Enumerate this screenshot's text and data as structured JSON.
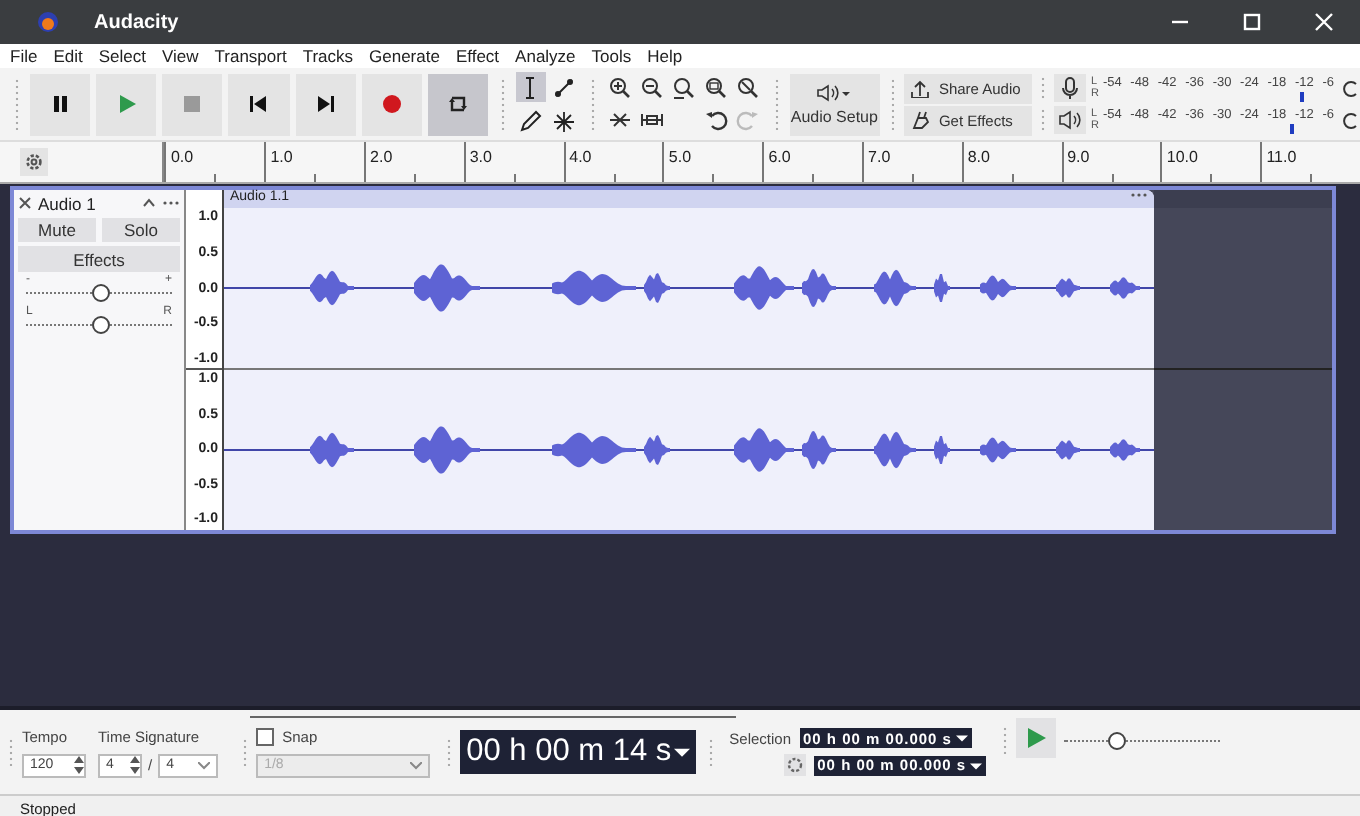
{
  "window": {
    "title": "Audacity"
  },
  "menu": [
    "File",
    "Edit",
    "Select",
    "View",
    "Transport",
    "Tracks",
    "Generate",
    "Effect",
    "Analyze",
    "Tools",
    "Help"
  ],
  "transport": [
    {
      "kind": "pause",
      "selected": false
    },
    {
      "kind": "play",
      "selected": false
    },
    {
      "kind": "stop",
      "selected": false
    },
    {
      "kind": "skip-start",
      "selected": false
    },
    {
      "kind": "skip-end",
      "selected": false
    },
    {
      "kind": "record",
      "selected": false
    },
    {
      "kind": "loop",
      "selected": true
    }
  ],
  "tools": [
    {
      "kind": "select",
      "selected": true
    },
    {
      "kind": "envelope",
      "selected": false
    },
    {
      "kind": "draw",
      "selected": false
    },
    {
      "kind": "multi",
      "selected": false
    }
  ],
  "history": [
    {
      "kind": "undo",
      "disabled": false
    },
    {
      "kind": "redo",
      "disabled": true
    }
  ],
  "audio_setup": {
    "label": "Audio Setup"
  },
  "share": [
    {
      "kind": "share",
      "label": "Share Audio"
    },
    {
      "kind": "effects",
      "label": "Get Effects"
    }
  ],
  "meters": [
    {
      "kind": "record",
      "left": "L",
      "right": "R",
      "scale": [
        "-54",
        "-48",
        "-42",
        "-36",
        "-30",
        "-24",
        "-18",
        "-12",
        "-6"
      ],
      "level": 0.84
    },
    {
      "kind": "playback",
      "left": "L",
      "right": "R",
      "scale": [
        "-54",
        "-48",
        "-42",
        "-36",
        "-30",
        "-24",
        "-18",
        "-12",
        "-6"
      ],
      "level": 0.8
    }
  ],
  "timeline": {
    "ticks": [
      "0.0",
      "1.0",
      "2.0",
      "3.0",
      "4.0",
      "5.0",
      "6.0",
      "7.0",
      "8.0",
      "9.0",
      "10.0",
      "11.0"
    ]
  },
  "track": {
    "name": "Audio 1",
    "buttons": [
      "Mute",
      "Solo"
    ],
    "effects": "Effects",
    "gain": {
      "min": "-",
      "max": "+",
      "level": 0.5
    },
    "pan": {
      "left": "L",
      "right": "R",
      "level": 0.5
    },
    "clip": "Audio 1.1",
    "channels": [
      {
        "scale": [
          "1.0",
          "0.5",
          "0.0",
          "-0.5",
          "-1.0"
        ]
      },
      {
        "scale": [
          "1.0",
          "0.5",
          "0.0",
          "-0.5",
          "-1.0"
        ]
      }
    ]
  },
  "bottom": {
    "tempo": {
      "label": "Tempo",
      "value": "120"
    },
    "time_signature": {
      "label": "Time Signature",
      "upper": "4",
      "separator": "/",
      "lower": "4"
    },
    "snap": {
      "label": "Snap",
      "checked": false,
      "value": "1/8",
      "disabled": true
    },
    "time": "00 h 00 m 14 s",
    "selection": {
      "label": "Selection",
      "start": "00 h 00 m 00.000 s",
      "end": "00 h 00 m 00.000 s"
    },
    "play_speed": {
      "level": 0.33
    }
  },
  "status": "Stopped"
}
